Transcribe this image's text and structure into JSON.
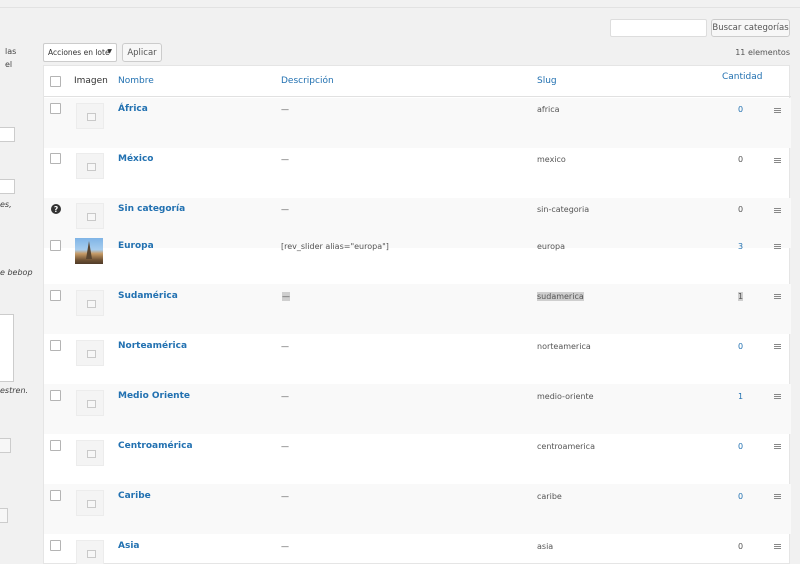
{
  "left_panel": {
    "fragments": [
      "las",
      "el",
      "es,",
      "e bebop",
      "estren."
    ]
  },
  "search": {
    "placeholder": "",
    "button_label": "Buscar categorías"
  },
  "bulk": {
    "selected": "Acciones en lote",
    "apply_label": "Aplicar",
    "count": "11 elementos"
  },
  "columns": {
    "image": "Imagen",
    "name": "Nombre",
    "description": "Descripción",
    "slug": "Slug",
    "count": "Cantidad"
  },
  "rows": [
    {
      "name": "África",
      "description": "—",
      "slug": "africa",
      "count": "0",
      "count_linked": true,
      "image": "placeholder",
      "checkbox": true
    },
    {
      "name": "México",
      "description": "—",
      "slug": "mexico",
      "count": "0",
      "count_linked": false,
      "image": "placeholder",
      "checkbox": true
    },
    {
      "name": "Sin categoría",
      "description": "—",
      "slug": "sin-categoria",
      "count": "0",
      "count_linked": false,
      "image": "placeholder",
      "checkbox": false,
      "help_icon": "help-icon"
    },
    {
      "name": "Europa",
      "description": "[rev_slider alias=\"europa\"]",
      "slug": "europa",
      "count": "3",
      "count_linked": true,
      "image": "photo-eiffel-tower",
      "checkbox": true
    },
    {
      "name": "Sudamérica",
      "description": "—",
      "slug": "sudamerica",
      "count": "1",
      "count_linked": false,
      "image": "placeholder",
      "checkbox": true,
      "highlighted": true
    },
    {
      "name": "Norteamérica",
      "description": "—",
      "slug": "norteamerica",
      "count": "0",
      "count_linked": true,
      "image": "placeholder",
      "checkbox": true
    },
    {
      "name": "Medio Oriente",
      "description": "—",
      "slug": "medio-oriente",
      "count": "1",
      "count_linked": true,
      "image": "placeholder",
      "checkbox": true
    },
    {
      "name": "Centroamérica",
      "description": "—",
      "slug": "centroamerica",
      "count": "0",
      "count_linked": true,
      "image": "placeholder",
      "checkbox": true
    },
    {
      "name": "Caribe",
      "description": "—",
      "slug": "caribe",
      "count": "0",
      "count_linked": true,
      "image": "placeholder",
      "checkbox": true
    },
    {
      "name": "Asia",
      "description": "—",
      "slug": "asia",
      "count": "0",
      "count_linked": false,
      "image": "placeholder",
      "checkbox": true
    }
  ],
  "colors": {
    "link": "#2271b1",
    "highlight": "#cfcfcf",
    "alt_row": "#f9f9f9"
  }
}
